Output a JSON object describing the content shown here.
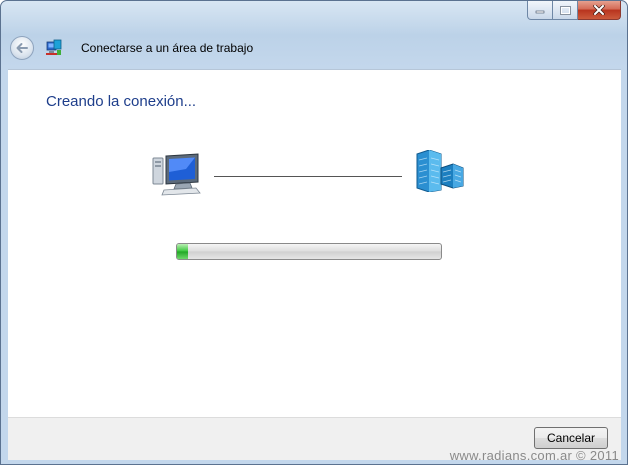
{
  "window": {
    "title": "Conectarse a un área de trabajo",
    "caption_buttons": {
      "minimize": "minimize",
      "maximize": "maximize",
      "close": "close"
    }
  },
  "content": {
    "heading": "Creando la conexión...",
    "progress": 0.04
  },
  "footer": {
    "cancel_label": "Cancelar"
  },
  "watermark": "www.radians.com.ar © 2011",
  "icons": {
    "back": "back-arrow-icon",
    "app": "network-connection-icon",
    "local": "computer-icon",
    "remote": "workplace-network-icon"
  },
  "colors": {
    "heading": "#1e3e8b",
    "progress_fill": "#2fb931",
    "close_button": "#c44a33"
  }
}
